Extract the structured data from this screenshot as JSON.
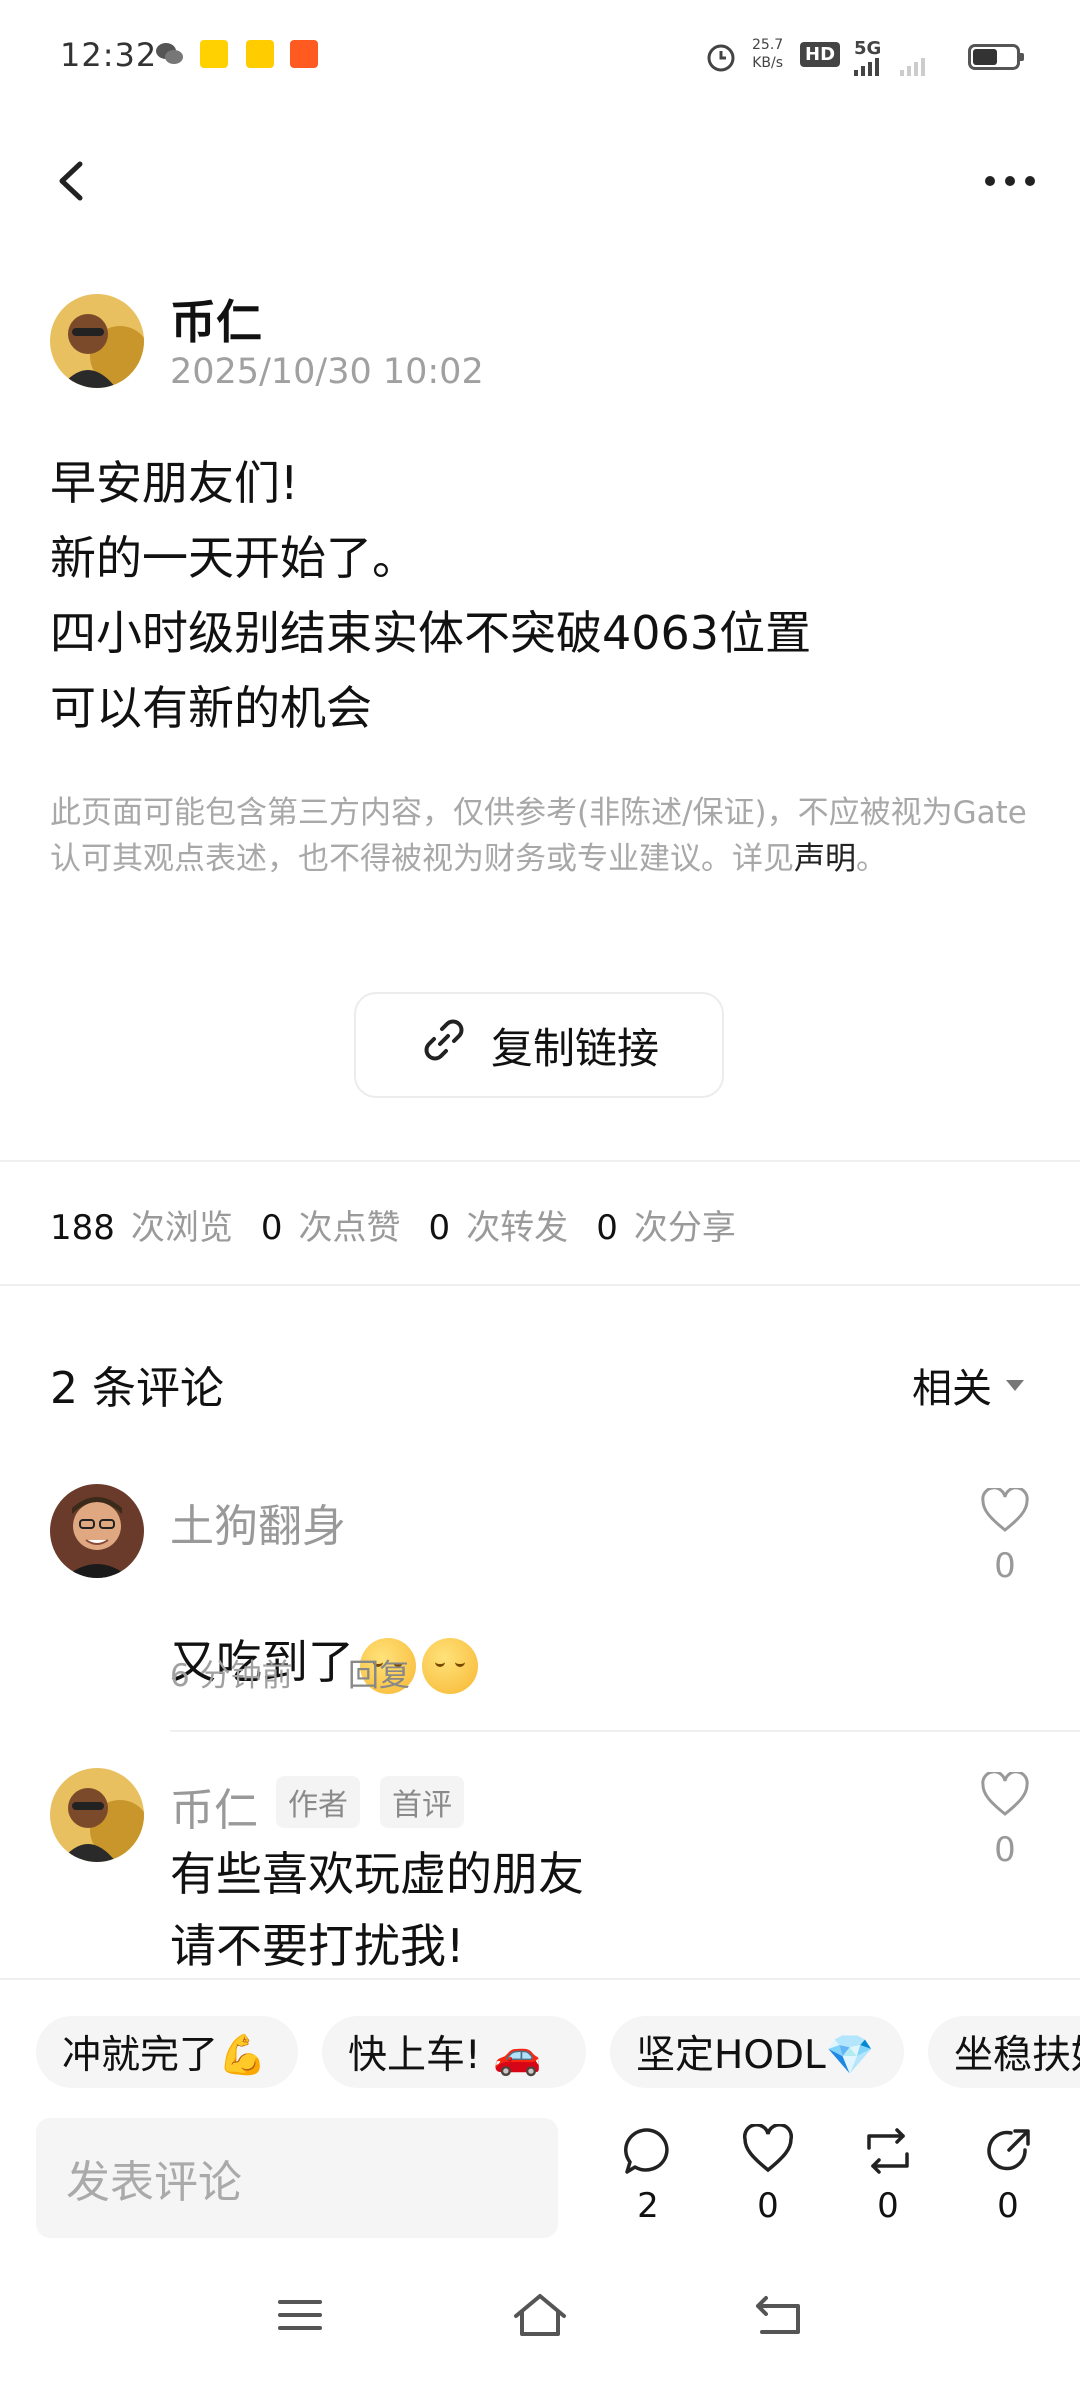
{
  "status_bar": {
    "time": "12:32",
    "net_speed": "25.7",
    "net_unit": "KB/s",
    "hd": "HD",
    "network": "5G"
  },
  "post": {
    "author": "币仁",
    "time": "2025/10/30 10:02",
    "body": "早安朋友们!\n新的一天开始了。\n四小时级别结束实体不突破4063位置\n可以有新的机会",
    "disclaimer_text": "此页面可能包含第三方内容，仅供参考(非陈述/保证)，不应被视为Gate认可其观点表述，也不得被视为财务或专业建议。详见",
    "disclaimer_link": "声明",
    "disclaimer_end": "。",
    "copy_link_label": "复制链接"
  },
  "stats": {
    "views": "188",
    "views_label": "次浏览",
    "likes": "0",
    "likes_label": "次点赞",
    "reposts": "0",
    "reposts_label": "次转发",
    "shares": "0",
    "shares_label": "次分享"
  },
  "comments_section": {
    "title": "2 条评论",
    "sort_label": "相关",
    "comments": [
      {
        "name": "土狗翻身",
        "text": "又吃到了",
        "time": "6 分钟前",
        "reply_label": "回复",
        "likes": "0"
      },
      {
        "name": "币仁",
        "tag_author": "作者",
        "tag_first": "首评",
        "text": "有些喜欢玩虚的朋友\n请不要打扰我!",
        "likes": "0"
      }
    ]
  },
  "quick_replies": [
    "冲就完了💪",
    "快上车! 🚗",
    "坚定HODL💎",
    "坐稳扶好"
  ],
  "bottom_bar": {
    "input_placeholder": "发表评论",
    "comment_count": "2",
    "like_count": "0",
    "repost_count": "0",
    "share_count": "0"
  },
  "colors": {
    "accent_text": "#111111",
    "muted": "#a0a0a0"
  }
}
